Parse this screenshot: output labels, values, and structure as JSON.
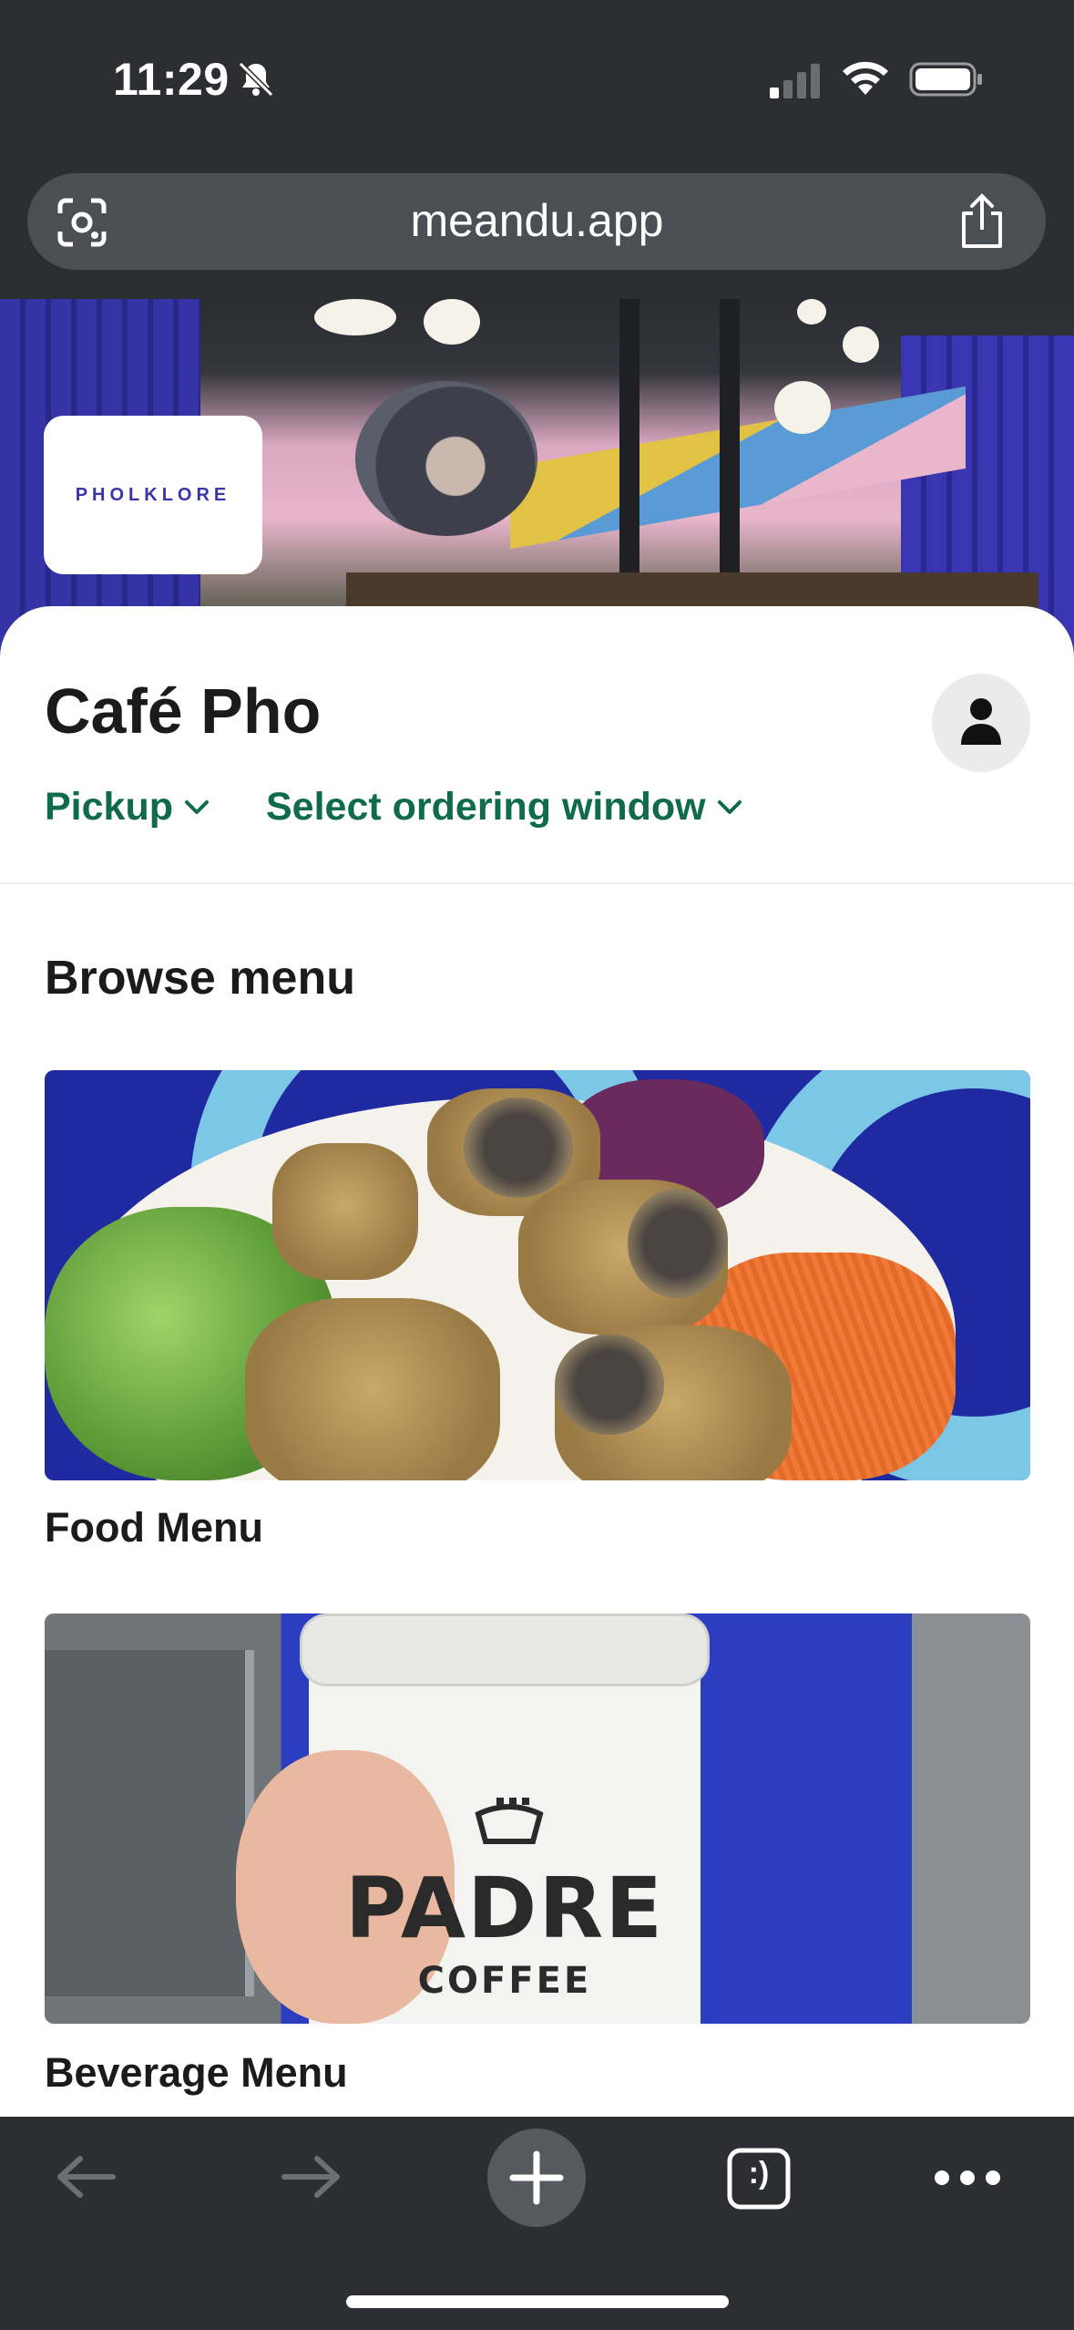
{
  "status_bar": {
    "time": "11:29",
    "icons": [
      "bell-slash-icon",
      "signal-icon",
      "wifi-icon",
      "battery-icon"
    ]
  },
  "browser": {
    "url": "meandu.app",
    "icons": [
      "lens-icon",
      "share-icon"
    ]
  },
  "venue": {
    "logo_text": "PHOLKLORE",
    "name": "Café Pho",
    "order_type": "Pickup",
    "ordering_window": "Select ordering window"
  },
  "menu": {
    "section_title": "Browse menu",
    "cards": [
      {
        "label": "Food Menu"
      },
      {
        "label": "Beverage Menu"
      }
    ]
  },
  "cup_print": {
    "brand": "PADRE",
    "sub": "COFFEE"
  },
  "toolbar": {
    "tabs_label": ":)",
    "icons": [
      "back-arrow-icon",
      "forward-arrow-icon",
      "plus-icon",
      "tabs-icon",
      "more-icon"
    ]
  },
  "colors": {
    "chrome": "#2c2e31",
    "accent_green": "#0f6b4a",
    "text": "#1b1b1b"
  }
}
